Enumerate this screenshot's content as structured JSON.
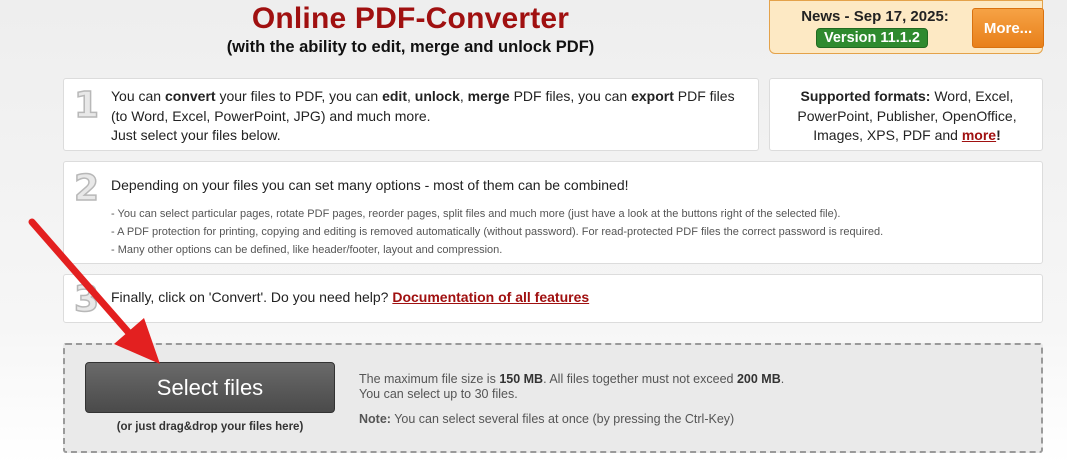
{
  "header": {
    "title": "Online PDF-Converter",
    "subtitle": "(with the ability to edit, merge and unlock PDF)"
  },
  "news": {
    "label": "News - Sep 17, 2025:",
    "version": "Version 11.1.2",
    "more_button": "More..."
  },
  "step1": {
    "number": "1",
    "t1": "You can ",
    "b1": "convert",
    "t2": " your files to PDF, you can ",
    "b2": "edit",
    "t3": ", ",
    "b3": "unlock",
    "t4": ", ",
    "b4": "merge",
    "t5": " PDF files, you can ",
    "b5": "export",
    "t6": " PDF files (to Word, Excel, PowerPoint, JPG) and much more.",
    "line3": "Just select your files below."
  },
  "formats": {
    "label": "Supported formats:",
    "list": " Word, Excel, PowerPoint, Publisher, OpenOffice, Images, XPS, PDF and ",
    "more_link": "more",
    "end": "!"
  },
  "step2": {
    "number": "2",
    "lead": "Depending on your files you can set many options - most of them can be combined!",
    "notes": [
      "- You can select particular pages, rotate PDF pages, reorder pages, split files and much more (just have a look at the buttons right of the selected file).",
      "- A PDF protection for printing, copying and editing is removed automatically (without password). For read-protected PDF files the correct password is required.",
      "- Many other options can be defined, like header/footer, layout and compression."
    ]
  },
  "step3": {
    "number": "3",
    "text": "Finally, click on 'Convert'. Do you need help? ",
    "doc_link": "Documentation of all features"
  },
  "upload": {
    "select_button": "Select files",
    "drag_note": "(or just drag&drop your files here)",
    "limit_t1": "The maximum file size is ",
    "limit_b1": "150 MB",
    "limit_t2": ". All files together must not exceed ",
    "limit_b2": "200 MB",
    "limit_t3": ".",
    "limit_line2": "You can select up to 30 files.",
    "note_label": "Note:",
    "note_text": " You can select several files at once (by pressing the Ctrl-Key)"
  },
  "colors": {
    "title_red": "#a01010",
    "version_green": "#2f8a2f",
    "more_orange": "#e8801a",
    "arrow_red": "#e32020"
  }
}
